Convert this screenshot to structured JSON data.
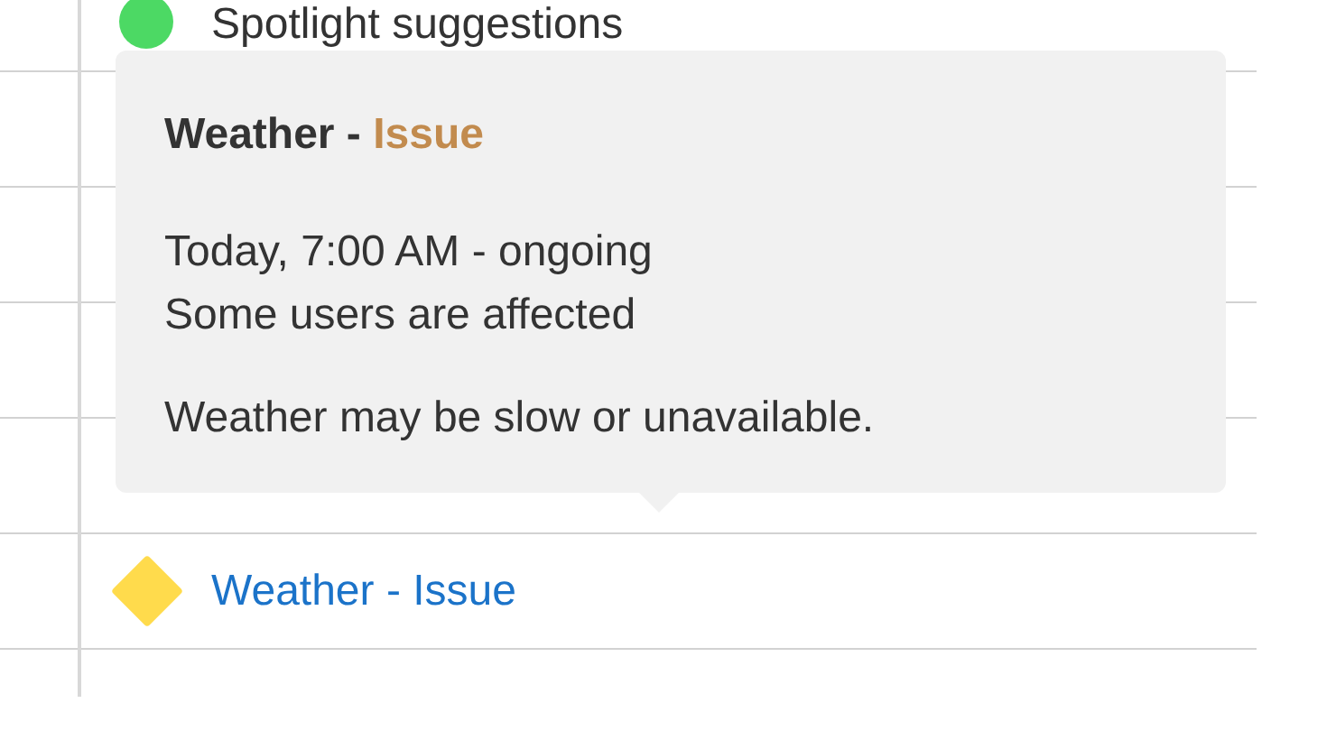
{
  "services": [
    {
      "kind": "dot",
      "name": "Spotlight suggestions",
      "color": "#4cd964"
    },
    {
      "kind": "blank"
    },
    {
      "kind": "blank"
    },
    {
      "kind": "blank"
    },
    {
      "kind": "blank"
    },
    {
      "kind": "diamond",
      "name": "Weather - Issue",
      "color": "#ffdb4c"
    }
  ],
  "tooltip": {
    "title": "Weather -",
    "status": "Issue",
    "period": "Today, 7:00 AM - ongoing",
    "affected": "Some users are affected",
    "message": "Weather may be slow or unavailable."
  }
}
